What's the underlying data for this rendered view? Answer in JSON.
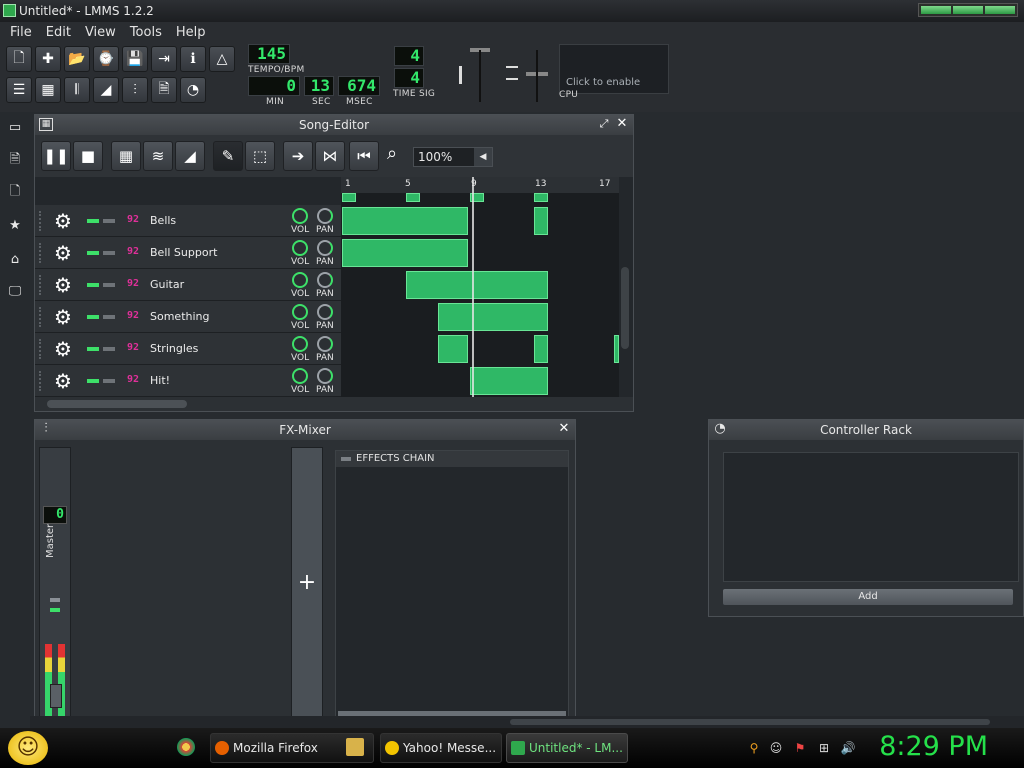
{
  "window": {
    "title": "Untitled* - LMMS 1.2.2"
  },
  "menu": [
    "File",
    "Edit",
    "View",
    "Tools",
    "Help"
  ],
  "toolbar": {
    "tempo": "145",
    "tempo_label": "TEMPO/BPM",
    "time_min": "0",
    "time_sec": "13",
    "time_msec": "674",
    "min_label": "MIN",
    "sec_label": "SEC",
    "msec_label": "MSEC",
    "timesig_num": "4",
    "timesig_den": "4",
    "timesig_label": "TIME SIG",
    "cpu_message": "Click to enable",
    "cpu_label": "CPU"
  },
  "song_editor": {
    "title": "Song-Editor",
    "zoom": "100%",
    "ruler_ticks": [
      "1",
      "5",
      "9",
      "13",
      "17"
    ],
    "tracks": [
      {
        "name": "Bells"
      },
      {
        "name": "Bell Support"
      },
      {
        "name": "Guitar"
      },
      {
        "name": "Something"
      },
      {
        "name": "Stringles"
      },
      {
        "name": "Hit!"
      }
    ],
    "vol_label": "VOL",
    "pan_label": "PAN"
  },
  "fx_mixer": {
    "title": "FX-Mixer",
    "master_value": "0",
    "master_label": "Master",
    "add_label": "+",
    "effects_chain_label": "EFFECTS CHAIN"
  },
  "controller_rack": {
    "title": "Controller Rack",
    "add_label": "Add"
  },
  "taskbar": {
    "tasks": [
      "Mozilla Firefox",
      "Yahoo! Messe...",
      "Untitled* - LM..."
    ],
    "clock": "8:29 PM"
  },
  "colors": {
    "accent": "#33e86b",
    "pattern": "#2fb866",
    "clock": "#25e04a"
  }
}
